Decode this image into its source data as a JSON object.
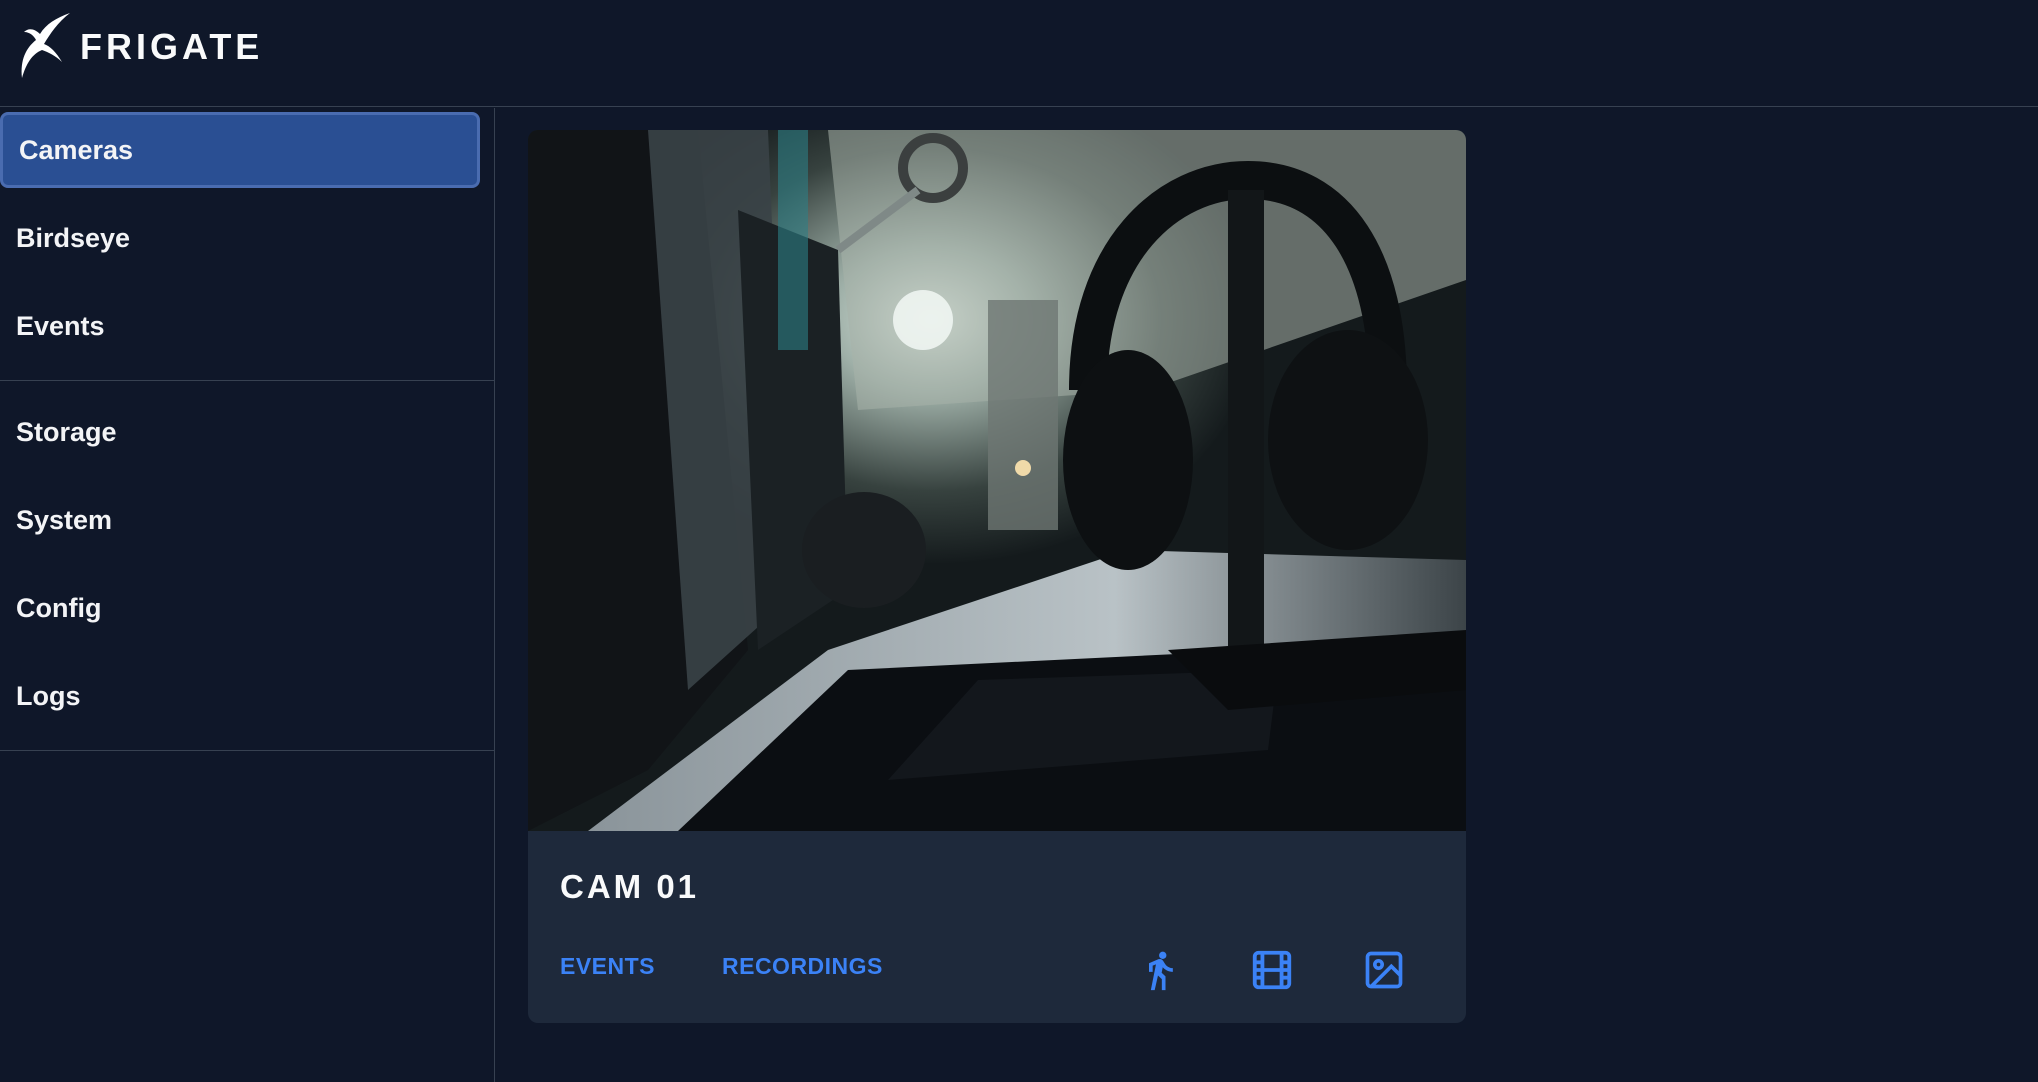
{
  "header": {
    "brand": "FRIGATE"
  },
  "sidebar": {
    "items": [
      {
        "label": "Cameras",
        "active": true
      },
      {
        "label": "Birdseye"
      },
      {
        "label": "Events"
      },
      {
        "label": "Storage"
      },
      {
        "label": "System"
      },
      {
        "label": "Config"
      },
      {
        "label": "Logs"
      }
    ]
  },
  "camera_card": {
    "name": "CAM 01",
    "events_label": "EVENTS",
    "recordings_label": "RECORDINGS",
    "icons": [
      "walking-person-icon",
      "film-icon",
      "image-icon"
    ]
  },
  "colors": {
    "background": "#0f1729",
    "card": "#1e293b",
    "active_nav": "#2a4f93",
    "accent": "#3b82f6"
  }
}
